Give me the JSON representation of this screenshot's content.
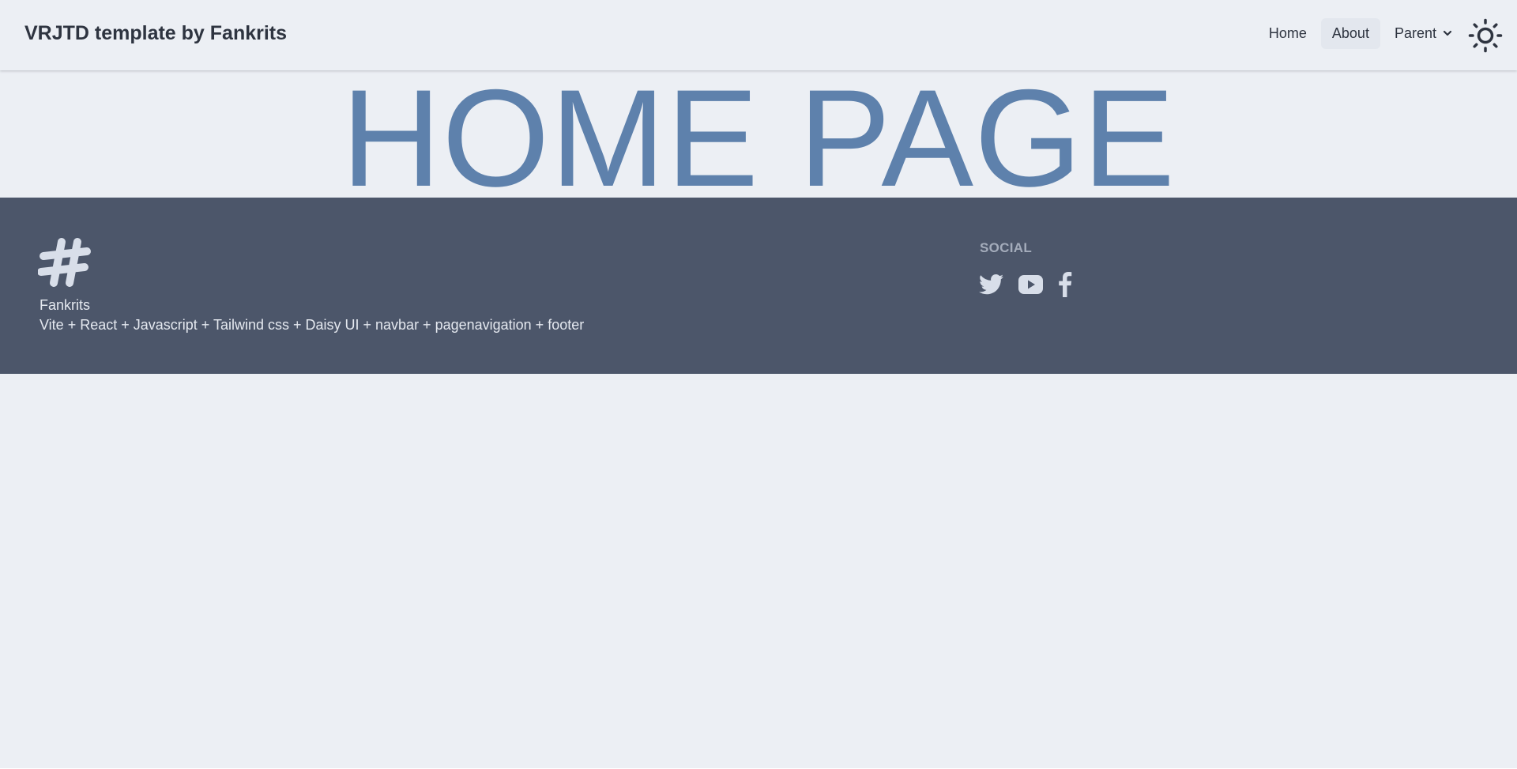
{
  "navbar": {
    "brand": "VRJTD template by Fankrits",
    "items": [
      {
        "label": "Home"
      },
      {
        "label": "About"
      },
      {
        "label": "Parent"
      }
    ],
    "theme_toggle_icon": "sun-icon"
  },
  "hero": {
    "title": "HOME PAGE"
  },
  "footer": {
    "logo_icon": "hashtag-icon",
    "name": "Fankrits",
    "description": "Vite + React + Javascript + Tailwind css + Daisy UI + navbar + pagenavigation + footer",
    "social": {
      "title": "SOCIAL",
      "icons": [
        "twitter-icon",
        "youtube-icon",
        "facebook-icon"
      ]
    }
  },
  "colors": {
    "background": "#eceff4",
    "hero_text": "#5e81ac",
    "footer_bg": "#4c566a",
    "footer_text": "#e5e9f0",
    "brand_text": "#2e3440"
  }
}
